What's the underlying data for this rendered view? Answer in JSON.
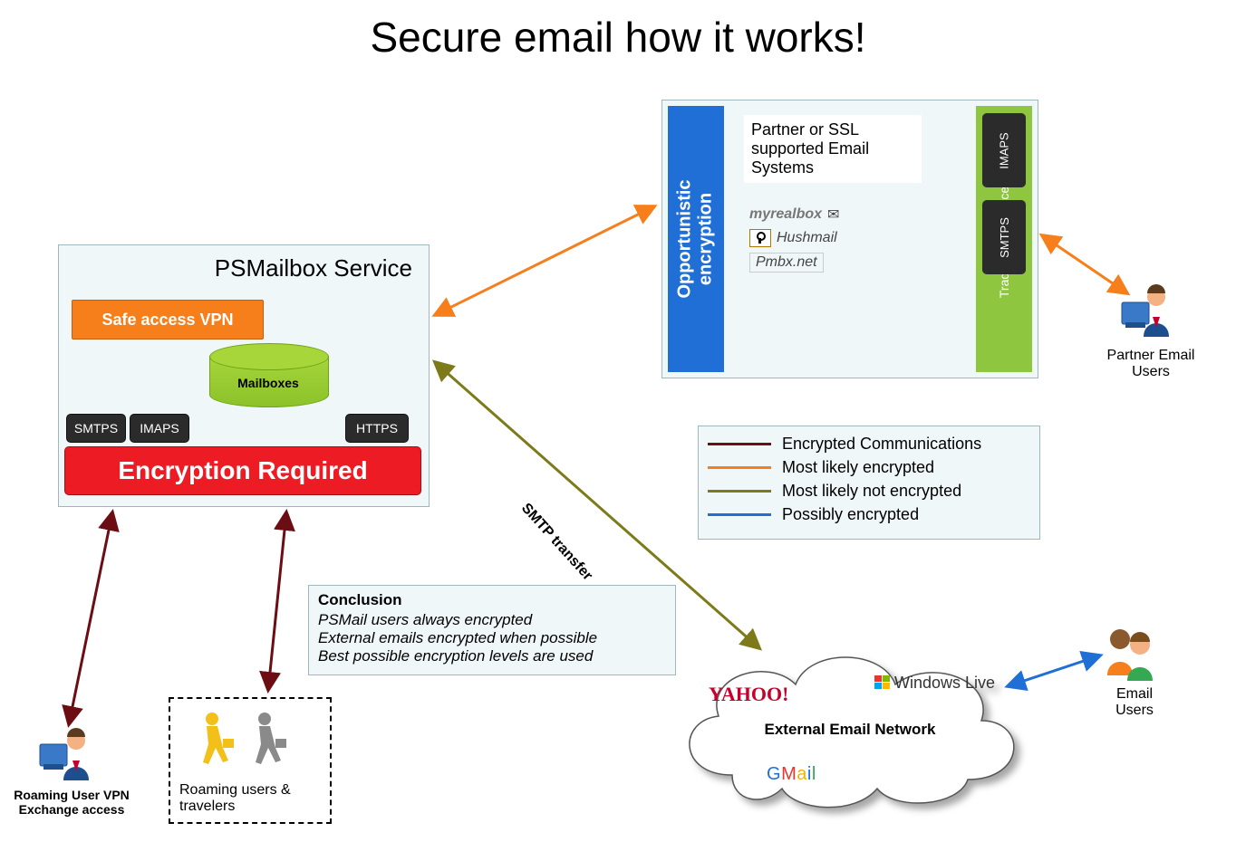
{
  "title": "Secure email how it works!",
  "psmailbox": {
    "title": "PSMailbox Service",
    "vpn_label": "Safe access VPN",
    "mailboxes_label": "Mailboxes",
    "protocols": {
      "smtps": "SMTPS",
      "imaps": "IMAPS",
      "https": "HTTPS"
    },
    "encryption_required": "Encryption Required"
  },
  "opportunistic": {
    "side_label": "Opportunistic encryption",
    "partner_text": "Partner or SSL supported Email Systems",
    "providers": {
      "myrealbox": "myrealbox",
      "hushmail": "Hushmail",
      "pmbx": "Pmbx.net"
    },
    "interfaces_label": "Traditional Interfaces",
    "protocols": {
      "imaps": "IMAPS",
      "smtps": "SMTPS"
    }
  },
  "legend": {
    "encrypted": "Encrypted Communications",
    "most_likely_encrypted": "Most likely encrypted",
    "most_likely_not_encrypted": "Most likely not encrypted",
    "possibly_encrypted": "Possibly encrypted",
    "colors": {
      "encrypted": "#6b0d12",
      "most_likely_encrypted": "#f77f1b",
      "most_likely_not_encrypted": "#7d7a1a",
      "possibly_encrypted": "#1f6fd6"
    }
  },
  "conclusion": {
    "heading": "Conclusion",
    "line1": "PSMail users always encrypted",
    "line2": "External emails encrypted when possible",
    "line3": "Best possible encryption levels are used"
  },
  "actors": {
    "partner_users": "Partner Email Users",
    "email_users": "Email Users",
    "roaming_vpn_user": "Roaming User VPN Exchange access",
    "roaming_travelers": "Roaming users & travelers"
  },
  "external_network": {
    "label": "External Email Network",
    "providers": {
      "yahoo": "YAHOO!",
      "windows_live": "Windows Live",
      "gmail": "GMail"
    }
  },
  "connections": {
    "smtp_transfer_label": "SMTP transfer"
  }
}
